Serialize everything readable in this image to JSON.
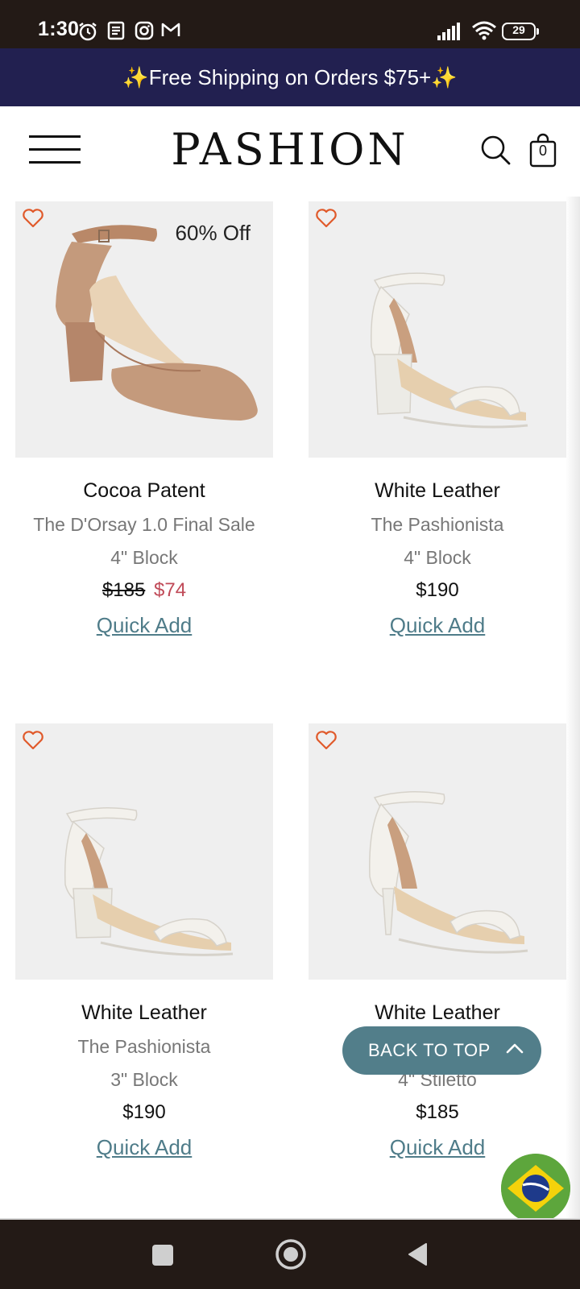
{
  "status_bar": {
    "time": "1:30",
    "battery": "29",
    "icons": [
      "alarm-icon",
      "news-icon",
      "instagram-icon",
      "gmail-icon",
      "signal-icon",
      "wifi-icon",
      "battery-icon"
    ]
  },
  "promo": {
    "text": "✨Free Shipping on Orders $75+✨"
  },
  "header": {
    "logo": "PASHION",
    "cart_count": "0"
  },
  "products": [
    {
      "color": "Cocoa Patent",
      "style": "The D'Orsay 1.0 Final Sale",
      "heel": "4\" Block",
      "price_original": "$185",
      "price_sale": "$74",
      "badge": "60% Off",
      "quick_add": "Quick Add",
      "shoe_color": "#c49a7c"
    },
    {
      "color": "White Leather",
      "style": "The Pashionista",
      "heel": "4\" Block",
      "price": "$190",
      "quick_add": "Quick Add",
      "shoe_color": "#f3f1ec"
    },
    {
      "color": "White Leather",
      "style": "The Pashionista",
      "heel": "3\" Block",
      "price": "$190",
      "quick_add": "Quick Add",
      "shoe_color": "#f3f1ec"
    },
    {
      "color": "White Leather",
      "style": "",
      "heel": "4\" Stiletto",
      "price": "$185",
      "quick_add": "Quick Add",
      "shoe_color": "#f3f1ec"
    }
  ],
  "back_to_top": {
    "label": "BACK TO TOP"
  },
  "colors": {
    "banner": "#222050",
    "accent": "#527e8a",
    "sale": "#c04a58",
    "heart": "#e05a2b"
  }
}
